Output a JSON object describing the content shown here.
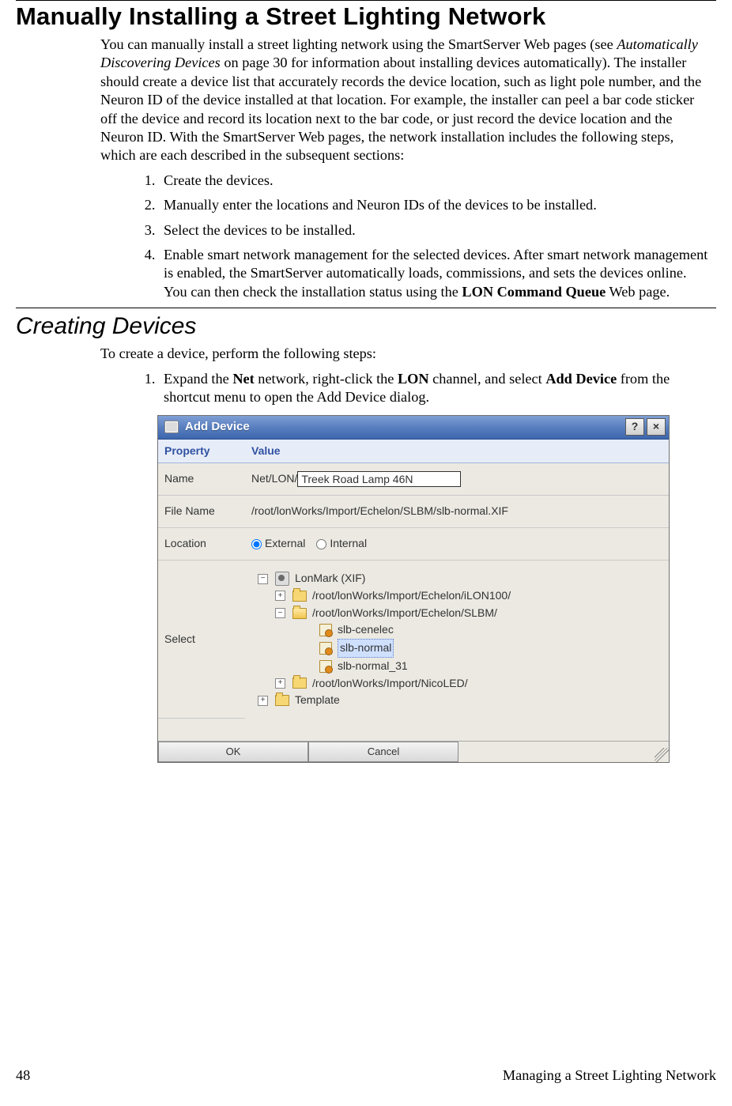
{
  "section_title": "Manually Installing a Street Lighting Network",
  "intro": {
    "pre_ref": "You can manually install a street lighting network using the SmartServer Web pages (see ",
    "ref": "Automatically Discovering Devices",
    "post_ref": " on page 30 for information about installing devices automatically).  The installer should create a device list that accurately records the device location, such as light pole number, and the Neuron ID of the device installed at that location.  For example, the installer can peel a bar code sticker off the device and record its location next to the bar code, or just record the device location and the Neuron ID.  With the SmartServer Web pages, the network installation includes the following steps, which are each described in the subsequent sections:"
  },
  "steps_a": [
    "Create the devices.",
    "Manually enter the locations and Neuron IDs of the devices to be installed.",
    "Select the devices to be installed.",
    {
      "pre": "Enable smart network management for the selected devices.  After smart network management is enabled, the SmartServer automatically loads, commissions, and sets the devices online.  You can then check the installation status using the ",
      "bold": "LON Command Queue",
      "post": " Web page."
    }
  ],
  "sub_title": "Creating Devices",
  "sub_intro": "To create a device, perform the following steps:",
  "steps_b1": {
    "p1": "Expand the ",
    "b1": "Net",
    "p2": " network, right-click the ",
    "b2": "LON",
    "p3": " channel, and select ",
    "b3": "Add Device",
    "p4": " from the shortcut menu to open the Add Device dialog."
  },
  "dialog": {
    "title": "Add Device",
    "help": "?",
    "close": "×",
    "headers": {
      "property": "Property",
      "value": "Value"
    },
    "name_label": "Name",
    "name_prefix": "Net/LON/",
    "name_input": "Treek Road Lamp 46N",
    "filename_label": "File Name",
    "filename_value": "/root/lonWorks/Import/Echelon/SLBM/slb-normal.XIF",
    "location_label": "Location",
    "location_opts": {
      "external": "External",
      "internal": "Internal"
    },
    "select_label": "Select",
    "tree": {
      "root": "LonMark (XIF)",
      "f1": "/root/lonWorks/Import/Echelon/iLON100/",
      "f2": "/root/lonWorks/Import/Echelon/SLBM/",
      "x1": "slb-cenelec",
      "x2": "slb-normal",
      "x3": "slb-normal_31",
      "f3": "/root/lonWorks/Import/NicoLED/",
      "t1": "Template"
    },
    "ok": "OK",
    "cancel": "Cancel"
  },
  "footer": {
    "page": "48",
    "title": "Managing a Street Lighting Network"
  }
}
